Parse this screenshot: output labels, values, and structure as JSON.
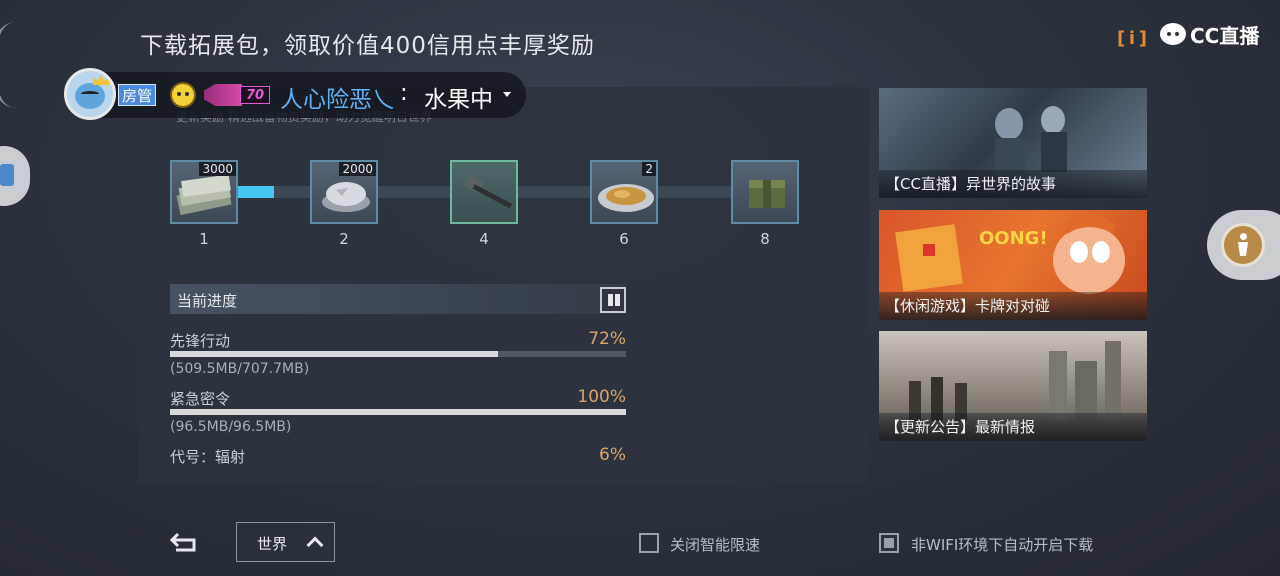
{
  "header": {
    "title": "下载拓展包，领取价值400信用点丰厚奖励",
    "info_label": "i",
    "cc_brand": "CC直播"
  },
  "chat": {
    "badge": "房管",
    "level": "70",
    "username": "人心险恶乀",
    "separator": ":",
    "message": "水果中"
  },
  "panel": {
    "subtitle": "更新奖励  精选战备物资奖励，助力觉醒明日世界",
    "rewards": [
      {
        "step": "1",
        "count": "3000",
        "icon": "cash-stack-icon"
      },
      {
        "step": "2",
        "count": "2000",
        "icon": "silver-ingot-icon"
      },
      {
        "step": "4",
        "count": "",
        "icon": "hammer-icon"
      },
      {
        "step": "6",
        "count": "2",
        "icon": "food-plate-icon"
      },
      {
        "step": "8",
        "count": "",
        "icon": "supply-crate-icon"
      }
    ],
    "progress_title": "当前进度",
    "packs": [
      {
        "name": "先锋行动",
        "percent": "72%",
        "fraction": 0.72,
        "size": "(509.5MB/707.7MB)"
      },
      {
        "name": "紧急密令",
        "percent": "100%",
        "fraction": 1.0,
        "size": "(96.5MB/96.5MB)"
      },
      {
        "name": "代号：辐射",
        "percent": "6%",
        "fraction": 0.06,
        "size": ""
      }
    ]
  },
  "cards": [
    {
      "label": "【CC直播】异世界的故事"
    },
    {
      "label": "【休闲游戏】卡牌对对碰"
    },
    {
      "label": "【更新公告】最新情报"
    }
  ],
  "bottom": {
    "channel": "世界",
    "smart_limit_label": "关闭智能限速",
    "smart_limit_checked": false,
    "auto_download_label": "非WIFI环境下自动开启下载",
    "auto_download_checked": true
  },
  "colors": {
    "accent_blue": "#43c7f2",
    "percent_orange": "#d9a56a",
    "username_blue": "#5fb1f2"
  }
}
